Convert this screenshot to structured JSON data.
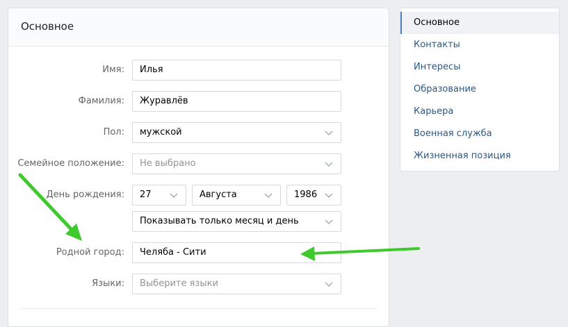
{
  "section": {
    "title": "Основное"
  },
  "form": {
    "first_name": {
      "label": "Имя:",
      "value": "Илья"
    },
    "last_name": {
      "label": "Фамилия:",
      "value": "Журавлёв"
    },
    "gender": {
      "label": "Пол:",
      "value": "мужской"
    },
    "marital_status": {
      "label": "Семейное положение:",
      "value": "Не выбрано"
    },
    "birthday": {
      "label": "День рождения:",
      "day": "27",
      "month": "Августа",
      "year": "1986",
      "visibility": "Показывать только месяц и день"
    },
    "hometown": {
      "label": "Родной город:",
      "value": "Челяба - Сити"
    },
    "languages": {
      "label": "Языки:",
      "placeholder": "Выберите языки"
    }
  },
  "nav": {
    "items": [
      {
        "label": "Основное",
        "active": true
      },
      {
        "label": "Контакты"
      },
      {
        "label": "Интересы"
      },
      {
        "label": "Образование"
      },
      {
        "label": "Карьера"
      },
      {
        "label": "Военная служба"
      },
      {
        "label": "Жизненная позиция"
      }
    ]
  },
  "colors": {
    "accent": "#5181b8",
    "link": "#2a5885",
    "arrow": "#3ec92d"
  },
  "icons": {
    "dropdown": "chevron-down-icon",
    "annotation": "arrow-icon"
  }
}
